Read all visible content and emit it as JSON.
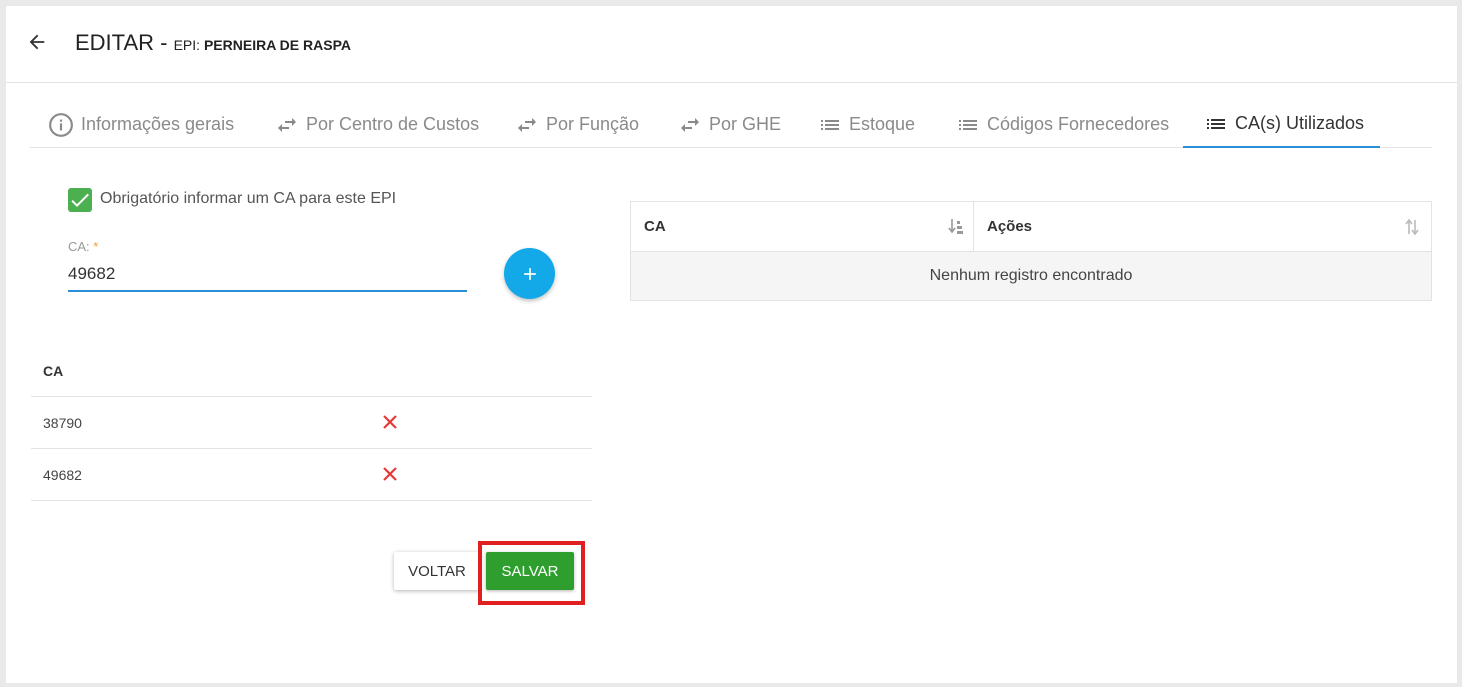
{
  "header": {
    "title_main": "EDITAR - ",
    "title_prefix": "EPI: ",
    "title_name": "PERNEIRA DE RASPA"
  },
  "tabs": [
    {
      "label": "Informações gerais",
      "icon": "info-icon"
    },
    {
      "label": "Por Centro de Custos",
      "icon": "swap-icon"
    },
    {
      "label": "Por Função",
      "icon": "swap-icon"
    },
    {
      "label": "Por GHE",
      "icon": "swap-icon"
    },
    {
      "label": "Estoque",
      "icon": "list-icon"
    },
    {
      "label": "Códigos Fornecedores",
      "icon": "list-icon"
    },
    {
      "label": "CA(s) Utilizados",
      "icon": "list-icon",
      "active": true
    }
  ],
  "form": {
    "checkbox_label": "Obrigatório informar um CA para este EPI",
    "checkbox_checked": true,
    "ca_label": "CA:",
    "ca_required": "*",
    "ca_value": "49682"
  },
  "left_table": {
    "header": "CA",
    "rows": [
      "38790",
      "49682"
    ]
  },
  "buttons": {
    "voltar": "VOLTAR",
    "salvar": "SALVAR"
  },
  "right_table": {
    "col_ca": "CA",
    "col_acoes": "Ações",
    "empty": "Nenhum registro encontrado"
  },
  "colors": {
    "accent_blue": "#2b8fd6",
    "add_button": "#13a9e8",
    "save_green": "#2e9e2e",
    "checkbox_green": "#4caf50",
    "highlight_red": "#e02020",
    "delete_red": "#e53935"
  }
}
